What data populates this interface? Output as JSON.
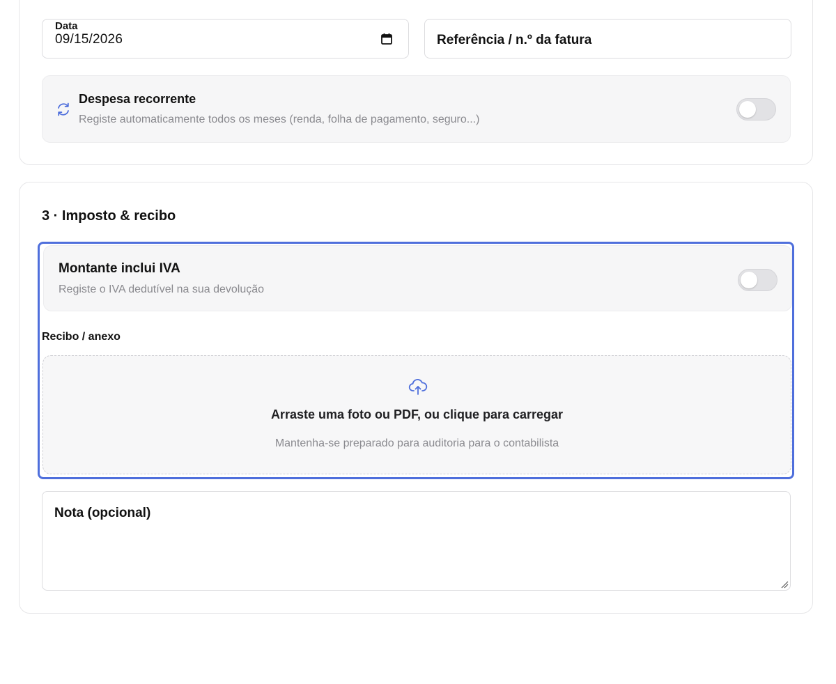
{
  "details": {
    "date_label": "Data",
    "date_value": "09/15/2026",
    "reference_label": "Referência / n.º da fatura",
    "recurring": {
      "title": "Despesa recorrente",
      "subtitle": "Registe automaticamente todos os meses (renda, folha de pagamento, seguro...)",
      "enabled": false,
      "icon": "refresh-icon"
    }
  },
  "tax_section": {
    "title": "3 · Imposto & recibo",
    "vat": {
      "title": "Montante inclui IVA",
      "subtitle": "Registe o IVA dedutível na sua devolução",
      "enabled": false
    },
    "receipt": {
      "label": "Recibo / anexo",
      "dropzone_title": "Arraste uma foto ou PDF, ou clique para carregar",
      "dropzone_subtitle": "Mantenha-se preparado para auditoria para o contabilista",
      "icon": "cloud-upload-icon"
    },
    "note_label": "Nota (opcional)"
  },
  "colors": {
    "accent": "#4f6fdc",
    "muted_text": "#8a8a8f",
    "toggle_off": "#e2e2e5"
  }
}
